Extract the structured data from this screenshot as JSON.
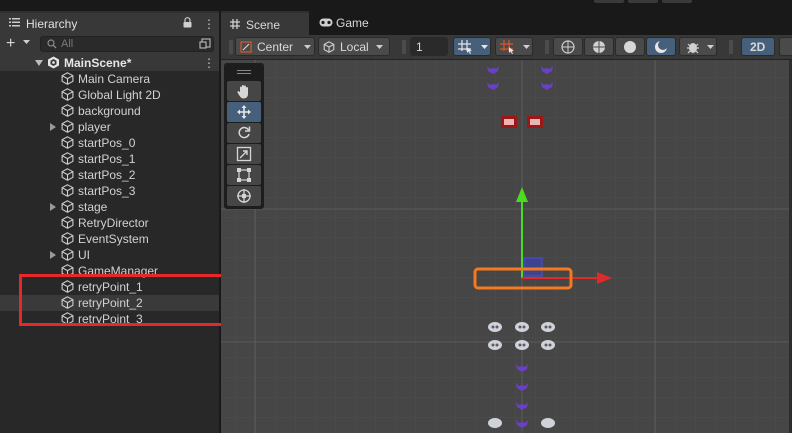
{
  "hierarchy": {
    "tab_title": "Hierarchy",
    "add_label": "+",
    "search_placeholder": "All",
    "scene_name": "MainScene*",
    "items": [
      {
        "label": "Main Camera",
        "expandable": false
      },
      {
        "label": "Global Light 2D",
        "expandable": false
      },
      {
        "label": "background",
        "expandable": false
      },
      {
        "label": "player",
        "expandable": true
      },
      {
        "label": "startPos_0",
        "expandable": false
      },
      {
        "label": "startPos_1",
        "expandable": false
      },
      {
        "label": "startPos_2",
        "expandable": false
      },
      {
        "label": "startPos_3",
        "expandable": false
      },
      {
        "label": "stage",
        "expandable": true
      },
      {
        "label": "RetryDirector",
        "expandable": false
      },
      {
        "label": "EventSystem",
        "expandable": false
      },
      {
        "label": "UI",
        "expandable": true
      },
      {
        "label": "GameManager",
        "expandable": false
      },
      {
        "label": "retryPoint_1",
        "expandable": false
      },
      {
        "label": "retryPoint_2",
        "expandable": false,
        "selected": true
      },
      {
        "label": "retryPoint_3",
        "expandable": false
      }
    ]
  },
  "scene": {
    "tabs": [
      {
        "label": "Scene",
        "active": true
      },
      {
        "label": "Game",
        "active": false
      }
    ],
    "toolbar": {
      "pivot_label": "Center",
      "space_label": "Local",
      "grid_size_value": "1",
      "mode_2d_label": "2D"
    },
    "tools": [
      "hand-tool",
      "move-tool",
      "rotate-tool",
      "scale-tool",
      "rect-tool",
      "transform-tool"
    ],
    "active_tool": "move-tool"
  },
  "colors": {
    "highlight_box": "#e8272b",
    "selection_outline": "#f47a1f",
    "gizmo_y": "#4bdc1f",
    "gizmo_x": "#e02a2a",
    "accent_selected": "#46607c"
  }
}
